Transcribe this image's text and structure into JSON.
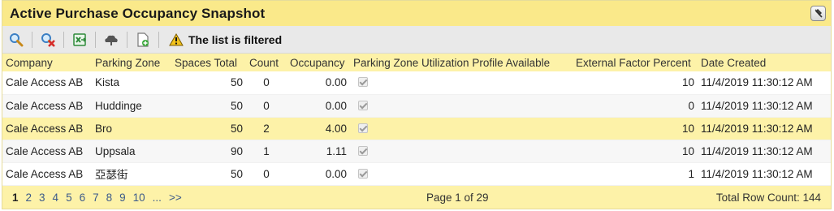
{
  "title": "Active Purchase Occupancy Snapshot",
  "toolbar": {
    "icons": [
      "search-icon",
      "clear-filter-icon",
      "export-excel-icon",
      "upload-icon",
      "new-document-icon"
    ],
    "filter_message": "The list is filtered"
  },
  "columns": {
    "company": "Company",
    "zone": "Parking Zone",
    "spaces": "Spaces Total",
    "count": "Count",
    "occupancy": "Occupancy",
    "profile": "Parking Zone Utilization Profile Available",
    "factor": "External Factor Percent",
    "date": "Date Created"
  },
  "rows": [
    {
      "company": "Cale Access AB",
      "zone": "Kista",
      "spaces": "50",
      "count": "0",
      "occupancy": "0.00",
      "profile": true,
      "factor": "10",
      "date": "11/4/2019 11:30:12 AM"
    },
    {
      "company": "Cale Access AB",
      "zone": "Huddinge",
      "spaces": "50",
      "count": "0",
      "occupancy": "0.00",
      "profile": true,
      "factor": "0",
      "date": "11/4/2019 11:30:12 AM"
    },
    {
      "company": "Cale Access AB",
      "zone": "Bro",
      "spaces": "50",
      "count": "2",
      "occupancy": "4.00",
      "profile": true,
      "factor": "10",
      "date": "11/4/2019 11:30:12 AM"
    },
    {
      "company": "Cale Access AB",
      "zone": "Uppsala",
      "spaces": "90",
      "count": "1",
      "occupancy": "1.11",
      "profile": true,
      "factor": "10",
      "date": "11/4/2019 11:30:12 AM"
    },
    {
      "company": "Cale Access AB",
      "zone": "亞瑟街",
      "spaces": "50",
      "count": "0",
      "occupancy": "0.00",
      "profile": true,
      "factor": "1",
      "date": "11/4/2019 11:30:12 AM"
    }
  ],
  "pager": {
    "pages": [
      "1",
      "2",
      "3",
      "4",
      "5",
      "6",
      "7",
      "8",
      "9",
      "10",
      "...",
      ">>"
    ],
    "current": "1",
    "page_info": "Page 1 of 29",
    "row_count": "Total Row Count: 144"
  },
  "colors": {
    "title_bar": "#fae98a",
    "header_row": "#fdf2a8",
    "highlight_row": "#fdf2a8",
    "pager_link": "#3c5a8a"
  }
}
